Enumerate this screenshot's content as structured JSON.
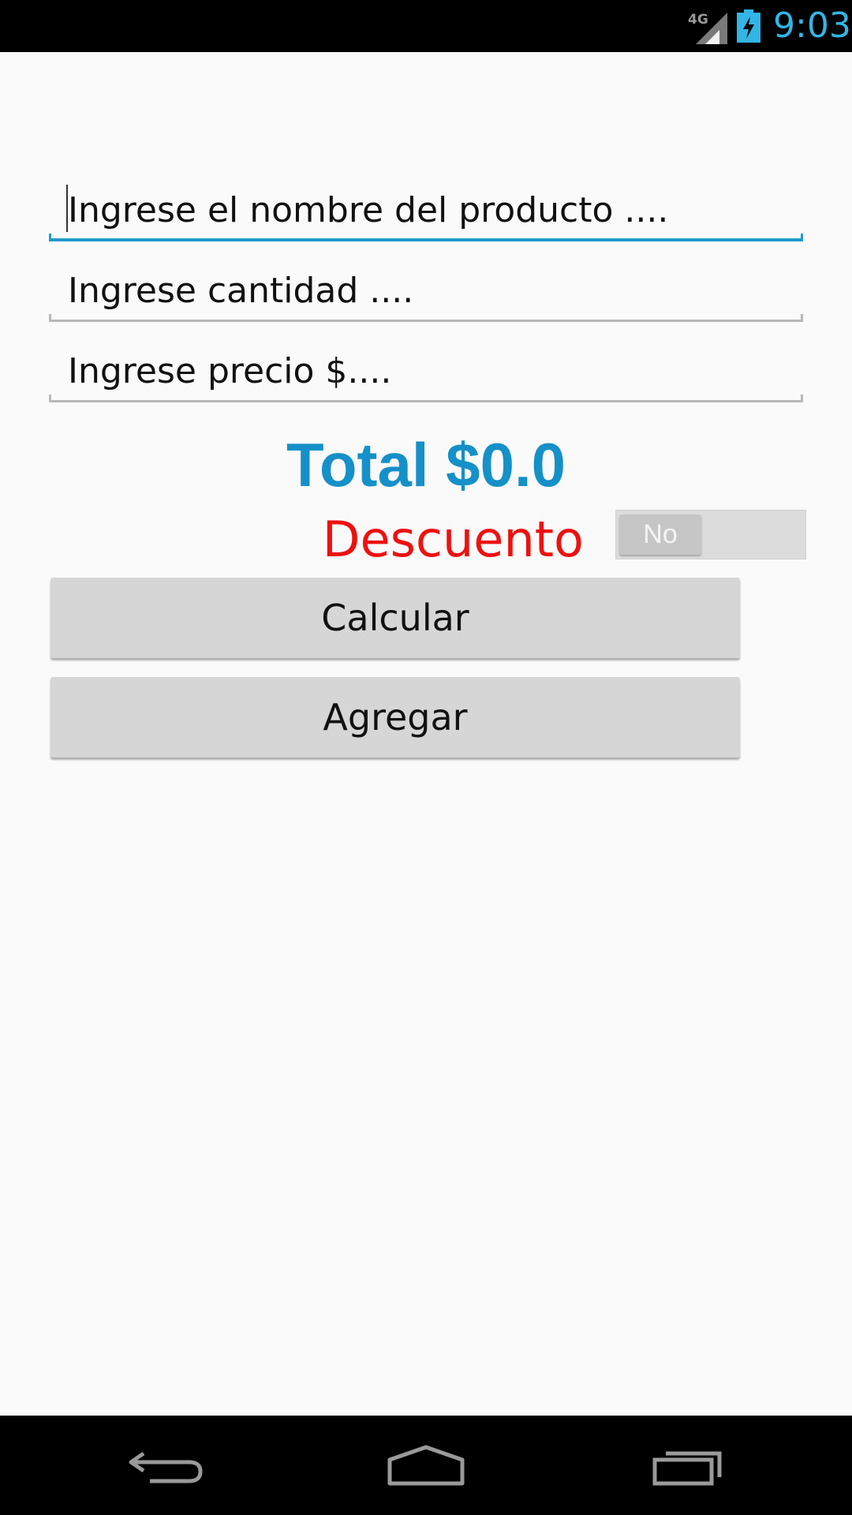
{
  "status_bar": {
    "network": "4G",
    "time": "9:03",
    "icons": [
      "signal-icon",
      "battery-charging-icon"
    ]
  },
  "form": {
    "product_name_placeholder": "Ingrese el nombre del producto ....",
    "quantity_placeholder": "Ingrese cantidad ....",
    "price_placeholder": "Ingrese precio $...."
  },
  "total": {
    "label": "Total $0.0"
  },
  "discount": {
    "label": "Descuento",
    "switch_state": "No"
  },
  "buttons": {
    "calculate": "Calcular",
    "add": "Agregar"
  },
  "colors": {
    "accent": "#33b5e5",
    "total": "#1590c8",
    "discount": "#ee1111"
  },
  "nav_bar": {
    "icons": [
      "back-icon",
      "home-icon",
      "recents-icon"
    ]
  }
}
